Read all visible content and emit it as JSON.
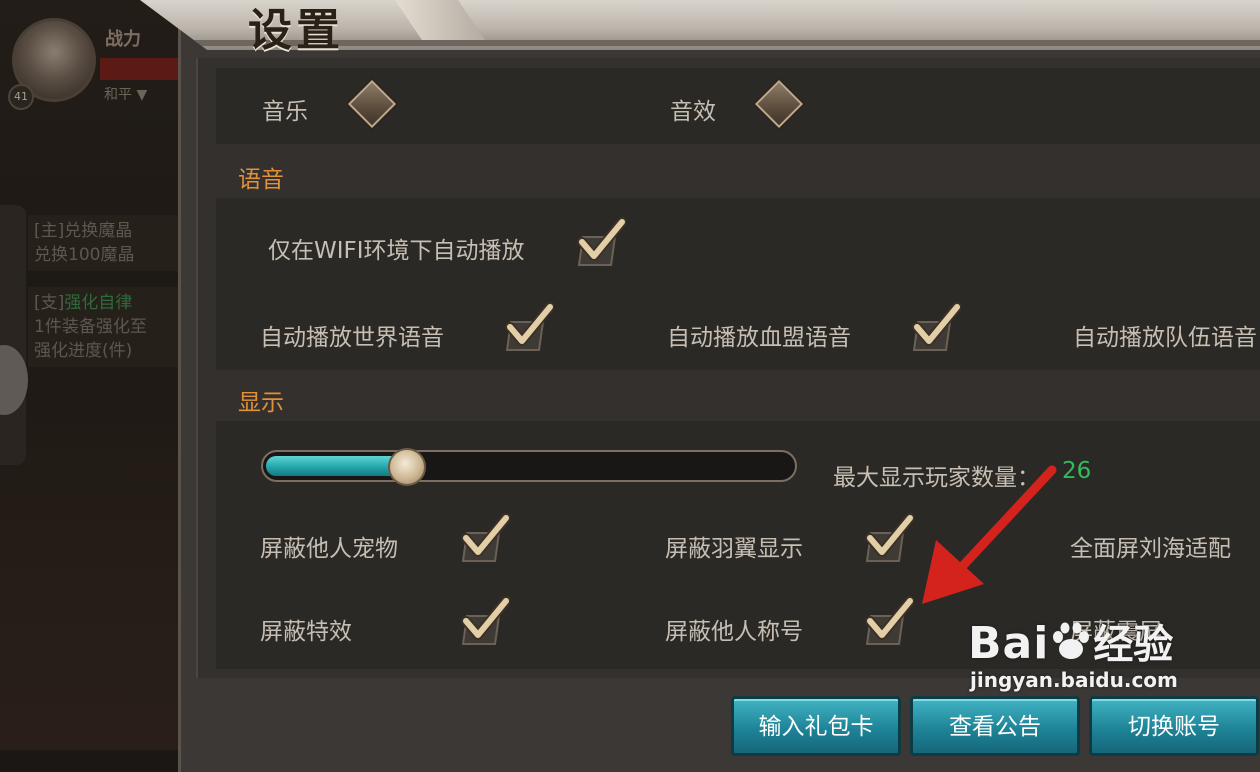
{
  "background_hud": {
    "level": "41",
    "power_label": "战力",
    "mode": "和平",
    "tasks": [
      {
        "tag": "[主]",
        "title": "兑换魔晶",
        "desc": "兑换100魔晶"
      },
      {
        "tag": "[支]",
        "title": "强化自律",
        "desc": "1件装备强化至",
        "extra": "强化进度(件)"
      }
    ]
  },
  "window": {
    "title": "设置"
  },
  "audio": {
    "music_label": "音乐",
    "sfx_label": "音效"
  },
  "voice": {
    "section_title": "语音",
    "wifi_autoplay_label": "仅在WIFI环境下自动播放",
    "world_voice_label": "自动播放世界语音",
    "guild_voice_label": "自动播放血盟语音",
    "team_voice_label": "自动播放队伍语音"
  },
  "display": {
    "section_title": "显示",
    "max_players_label": "最大显示玩家数量：",
    "max_players_value": "26",
    "max_players_fraction": 0.27,
    "hide_pets_label": "屏蔽他人宠物",
    "hide_wings_label": "屏蔽羽翼显示",
    "fullscreen_notch_label": "全面屏刘海适配",
    "hide_effects_label": "屏蔽特效",
    "hide_titles_label": "屏蔽他人称号",
    "hide_shake_label": "屏蔽震屏"
  },
  "buttons": {
    "gift_code": "输入礼包卡",
    "announcement": "查看公告",
    "switch_account": "切换账号"
  },
  "colors": {
    "section_title": "#e0913a",
    "slider_fill": "#20a2a8",
    "value_green": "#2fbd5a",
    "button_teal": "#1f8498",
    "annotation_arrow": "#d3231c"
  },
  "watermark": {
    "logo_left": "Bai",
    "logo_right": "经验",
    "url": "jingyan.baidu.com"
  }
}
